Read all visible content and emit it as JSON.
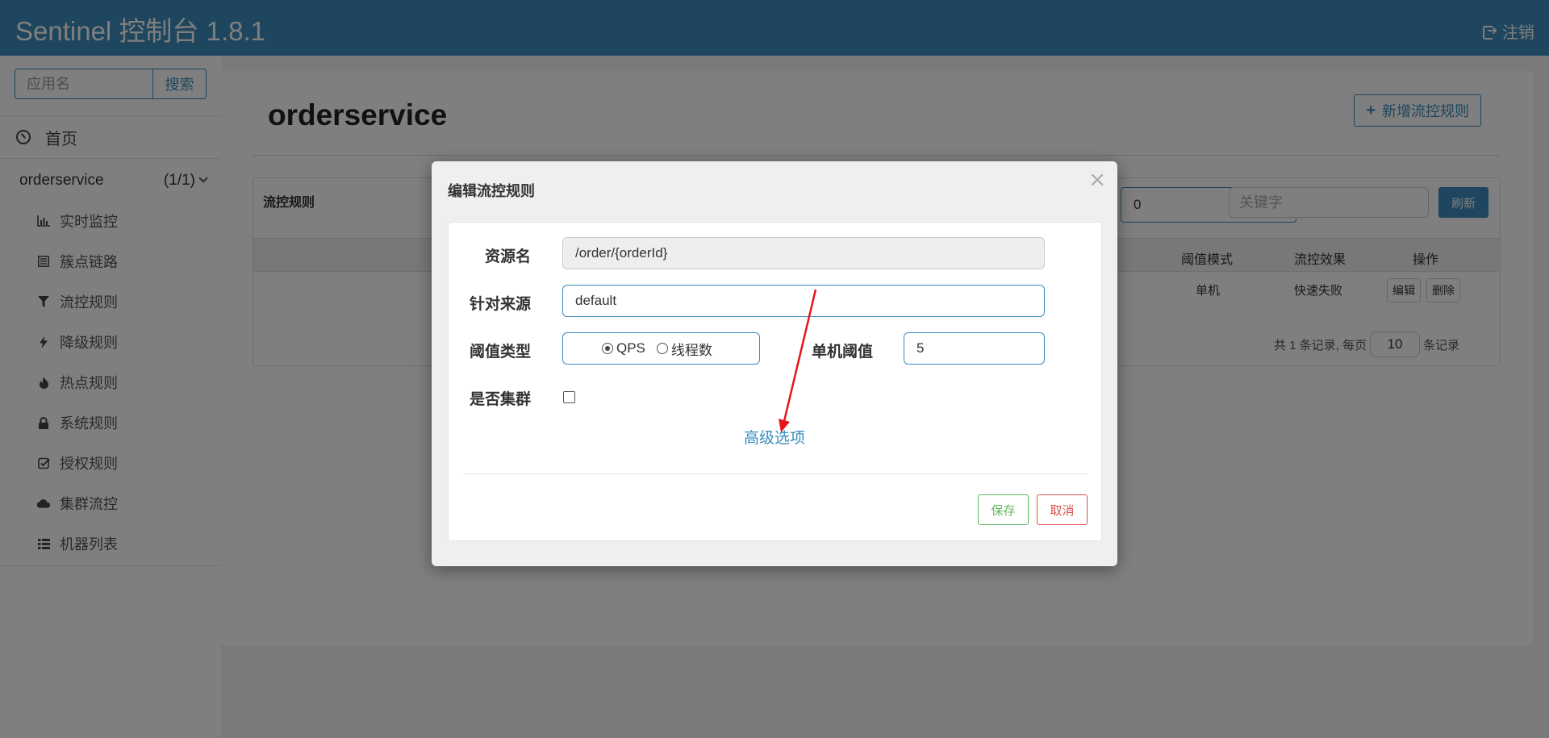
{
  "header": {
    "title": "Sentinel 控制台 1.8.1",
    "logout_label": "注销"
  },
  "sidebar": {
    "search_placeholder": "应用名",
    "search_button": "搜索",
    "home_label": "首页",
    "app": {
      "name": "orderservice",
      "count": "(1/1)"
    },
    "items": [
      {
        "label": "实时监控",
        "icon": "bar-chart-icon"
      },
      {
        "label": "簇点链路",
        "icon": "list-icon"
      },
      {
        "label": "流控规则",
        "icon": "filter-icon"
      },
      {
        "label": "降级规则",
        "icon": "flash-icon"
      },
      {
        "label": "热点规则",
        "icon": "fire-icon"
      },
      {
        "label": "系统规则",
        "icon": "lock-icon"
      },
      {
        "label": "授权规则",
        "icon": "check-icon"
      },
      {
        "label": "集群流控",
        "icon": "cloud-icon"
      },
      {
        "label": "机器列表",
        "icon": "list-alt-icon"
      }
    ]
  },
  "main": {
    "page_title": "orderservice",
    "add_button": "新增流控规则",
    "panel_title": "流控规则",
    "machine_select_value": "0",
    "keyword_placeholder": "关键字",
    "refresh_button": "刷新",
    "columns": [
      "阈值模式",
      "流控效果",
      "操作"
    ],
    "row": {
      "threshold_mode": "单机",
      "effect": "快速失败",
      "edit": "编辑",
      "delete": "删除"
    },
    "pager": {
      "prefix": "共 1 条记录, 每页",
      "page_size": "10",
      "suffix": "条记录"
    }
  },
  "modal": {
    "title": "编辑流控规则",
    "close_label": "×",
    "resource_label": "资源名",
    "resource_value": "/order/{orderId}",
    "origin_label": "针对来源",
    "origin_value": "default",
    "threshold_type_label": "阈值类型",
    "threshold_type_options": [
      "QPS",
      "线程数"
    ],
    "threshold_type_selected": "QPS",
    "single_threshold_label": "单机阈值",
    "single_threshold_value": "5",
    "cluster_label": "是否集群",
    "cluster_checked": false,
    "advanced_link": "高级选项",
    "save_button": "保存",
    "cancel_button": "取消"
  },
  "colors": {
    "primary": "#3c8dbc",
    "success": "#5cb85c",
    "danger": "#d9534f",
    "annotation": "#e8141a"
  }
}
